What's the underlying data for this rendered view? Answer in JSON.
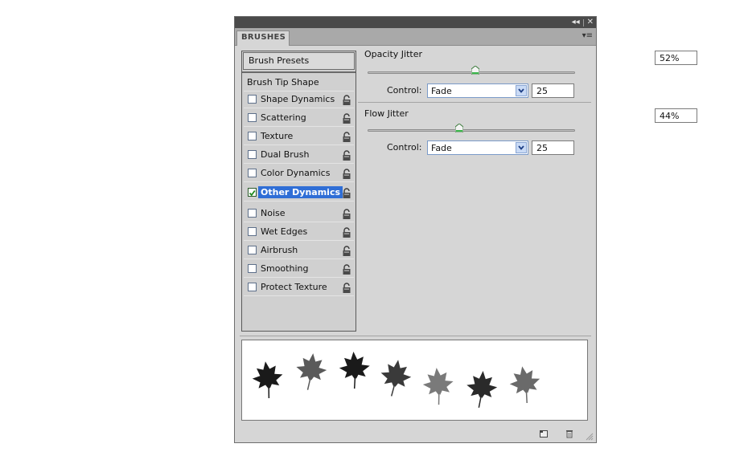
{
  "panel": {
    "title": "BRUSHES",
    "title_btn_collapse": "◂◂",
    "title_btn_close": "✕",
    "menu_icon": "▾≡"
  },
  "left": {
    "brush_presets": "Brush Presets",
    "brush_tip_shape": "Brush Tip Shape",
    "options": [
      {
        "label": "Shape Dynamics",
        "checked": false
      },
      {
        "label": "Scattering",
        "checked": false
      },
      {
        "label": "Texture",
        "checked": false
      },
      {
        "label": "Dual Brush",
        "checked": false
      },
      {
        "label": "Color Dynamics",
        "checked": false
      },
      {
        "label": "Other Dynamics",
        "checked": true,
        "selected": true
      },
      {
        "label": "Noise",
        "checked": false
      },
      {
        "label": "Wet Edges",
        "checked": false
      },
      {
        "label": "Airbrush",
        "checked": false
      },
      {
        "label": "Smoothing",
        "checked": false
      },
      {
        "label": "Protect Texture",
        "checked": false
      }
    ]
  },
  "opacity": {
    "label": "Opacity Jitter",
    "value": "52%",
    "slider_fraction": 0.52,
    "control_label": "Control:",
    "control_value": "Fade",
    "steps": "25"
  },
  "flow": {
    "label": "Flow Jitter",
    "value": "44%",
    "slider_fraction": 0.44,
    "control_label": "Control:",
    "control_value": "Fade",
    "steps": "25"
  },
  "preview": {
    "leaf_grays": [
      "#1a1a1a",
      "#5a5a5a",
      "#1a1a1a",
      "#3a3a3a",
      "#7a7a7a",
      "#2a2a2a",
      "#6a6a6a"
    ]
  },
  "icons": {
    "new_brush": "new-brush-icon",
    "delete_brush": "trash-icon",
    "resize": "resize-grip-icon",
    "lock": "lock-icon"
  }
}
